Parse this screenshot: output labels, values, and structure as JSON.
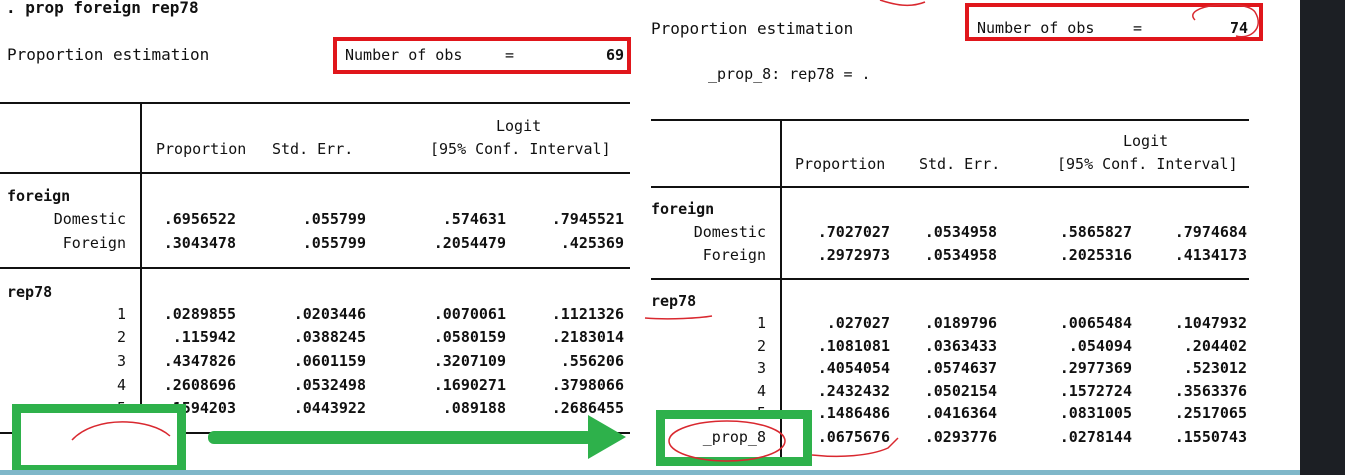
{
  "command": ". prop foreign rep78",
  "left": {
    "title": "Proportion estimation",
    "nobs_label": "Number of obs",
    "nobs_eq": "=",
    "nobs_value": "69",
    "headers": {
      "logit": "Logit",
      "proportion": "Proportion",
      "se": "Std. Err.",
      "ci": "[95% Conf. Interval]"
    },
    "groups": [
      {
        "name": "foreign",
        "rows": [
          {
            "label": "Domestic",
            "values": [
              ".6956522",
              ".055799",
              ".574631",
              ".7945521"
            ]
          },
          {
            "label": "Foreign",
            "values": [
              ".3043478",
              ".055799",
              ".2054479",
              ".425369"
            ]
          }
        ]
      },
      {
        "name": "rep78",
        "rows": [
          {
            "label": "1",
            "values": [
              ".0289855",
              ".0203446",
              ".0070061",
              ".1121326"
            ]
          },
          {
            "label": "2",
            "values": [
              ".115942",
              ".0388245",
              ".0580159",
              ".2183014"
            ]
          },
          {
            "label": "3",
            "values": [
              ".4347826",
              ".0601159",
              ".3207109",
              ".556206"
            ]
          },
          {
            "label": "4",
            "values": [
              ".2608696",
              ".0532498",
              ".1690271",
              ".3798066"
            ]
          },
          {
            "label": "5",
            "values": [
              ".1594203",
              ".0443922",
              ".089188",
              ".2686455"
            ]
          }
        ]
      }
    ]
  },
  "right": {
    "title": "Proportion estimation",
    "nobs_label": "Number of obs",
    "nobs_eq": "=",
    "nobs_value": "74",
    "note": "_prop_8: rep78 = .",
    "headers": {
      "logit": "Logit",
      "proportion": "Proportion",
      "se": "Std. Err.",
      "ci": "[95% Conf. Interval]"
    },
    "groups": [
      {
        "name": "foreign",
        "rows": [
          {
            "label": "Domestic",
            "values": [
              ".7027027",
              ".0534958",
              ".5865827",
              ".7974684"
            ]
          },
          {
            "label": "Foreign",
            "values": [
              ".2972973",
              ".0534958",
              ".2025316",
              ".4134173"
            ]
          }
        ]
      },
      {
        "name": "rep78",
        "rows": [
          {
            "label": "1",
            "values": [
              ".027027",
              ".0189796",
              ".0065484",
              ".1047932"
            ]
          },
          {
            "label": "2",
            "values": [
              ".1081081",
              ".0363433",
              ".054094",
              ".204402"
            ]
          },
          {
            "label": "3",
            "values": [
              ".4054054",
              ".0574637",
              ".2977369",
              ".523012"
            ]
          },
          {
            "label": "4",
            "values": [
              ".2432432",
              ".0502154",
              ".1572724",
              ".3563376"
            ]
          },
          {
            "label": "5",
            "values": [
              ".1486486",
              ".0416364",
              ".0831005",
              ".2517065"
            ]
          },
          {
            "label": "_prop_8",
            "values": [
              ".0675676",
              ".0293776",
              ".0278144",
              ".1550743"
            ]
          }
        ]
      }
    ]
  },
  "colors": {
    "highlight_red": "#e0161b",
    "highlight_green": "#2eb14b",
    "ink_red": "#d9282f"
  }
}
